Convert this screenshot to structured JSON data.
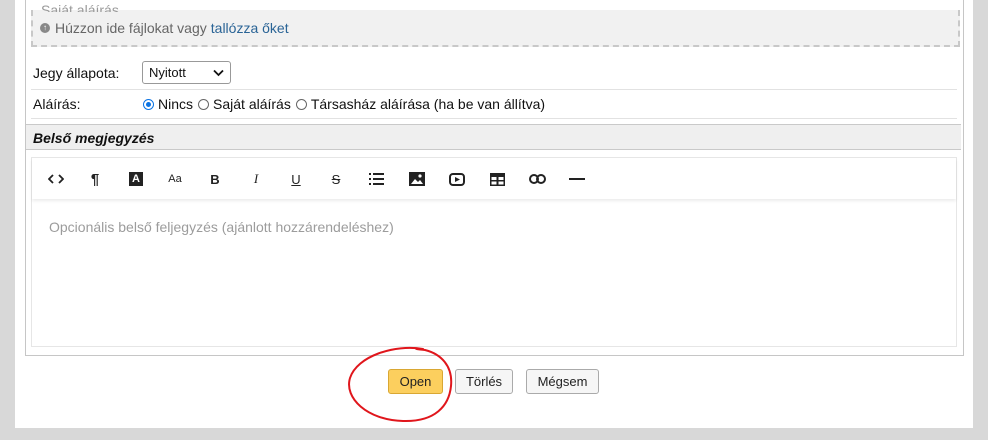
{
  "attachments": {
    "signature_ghost": "Saját aláírás",
    "drop_text": "Húzzon ide fájlokat vagy",
    "browse_link": "tallózza őket",
    "upload_icon": "upload-circle-icon"
  },
  "ticket_status": {
    "label": "Jegy állapota:",
    "selected": "Nyitott"
  },
  "signature": {
    "label": "Aláírás:",
    "options": [
      {
        "label": "Nincs",
        "checked": true
      },
      {
        "label": "Saját aláírás",
        "checked": false
      },
      {
        "label": "Társasház aláírása (ha be van állítva)",
        "checked": false
      }
    ]
  },
  "internal_note": {
    "title": "Belső megjegyzés",
    "placeholder": "Opcionális belső feljegyzés (ajánlott hozzárendeléshez)",
    "toolbar": [
      {
        "name": "code-view",
        "glyph": "<>"
      },
      {
        "name": "paragraph",
        "glyph": "¶"
      },
      {
        "name": "font-color",
        "glyph": "A"
      },
      {
        "name": "font-size",
        "glyph": "Aa"
      },
      {
        "name": "bold",
        "glyph": "B"
      },
      {
        "name": "italic",
        "glyph": "I"
      },
      {
        "name": "underline",
        "glyph": "U"
      },
      {
        "name": "strikethrough",
        "glyph": "S"
      },
      {
        "name": "list",
        "glyph": "list"
      },
      {
        "name": "image",
        "glyph": "image"
      },
      {
        "name": "video",
        "glyph": "video"
      },
      {
        "name": "table",
        "glyph": "table"
      },
      {
        "name": "link",
        "glyph": "link"
      },
      {
        "name": "horizontal-rule",
        "glyph": "—"
      }
    ]
  },
  "actions": {
    "open": "Open",
    "delete": "Törlés",
    "cancel": "Mégsem"
  },
  "colors": {
    "primary_button": "#fccf5e",
    "annotation": "#e0161c",
    "link": "#2a6496"
  }
}
